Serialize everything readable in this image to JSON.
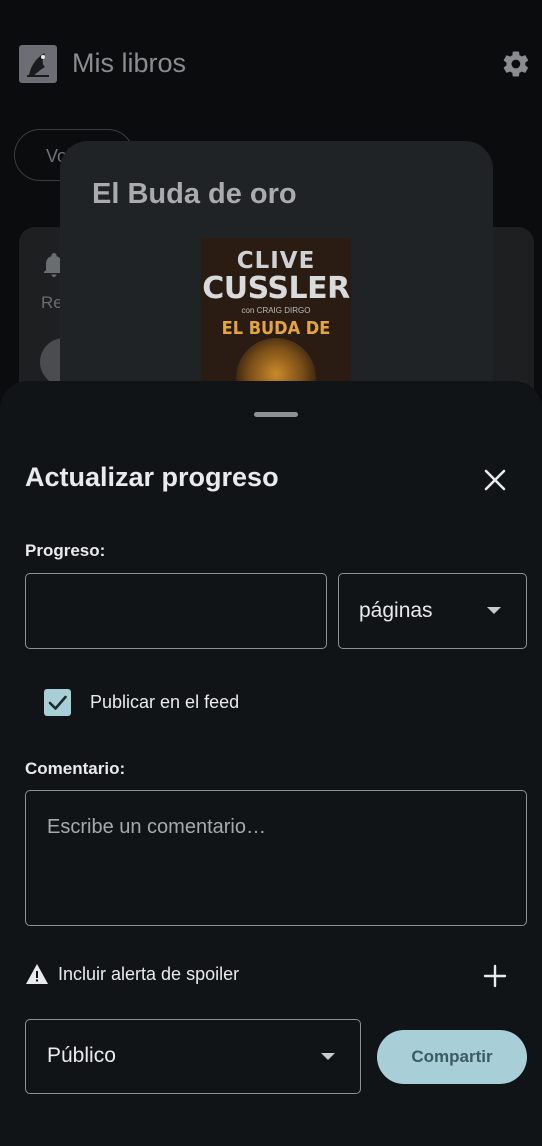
{
  "app": {
    "title": "Mis libros",
    "filter_chip": "Vol",
    "card_text_fragment": "Re"
  },
  "book": {
    "title": "El Buda de oro",
    "cover": {
      "author_first": "CLIVE",
      "author_last": "CUSSLER",
      "coauthor": "con CRAIG DIRGO",
      "title": "EL BUDA DE ORO"
    }
  },
  "sheet": {
    "title": "Actualizar progreso",
    "progress_label": "Progreso:",
    "progress_value": "",
    "unit_selected": "páginas",
    "post_to_feed_label": "Publicar en el feed",
    "post_to_feed_checked": true,
    "comment_label": "Comentario:",
    "comment_placeholder": "Escribe un comentario…",
    "spoiler_label": "Incluir alerta de spoiler",
    "visibility_selected": "Público",
    "share_label": "Compartir"
  },
  "colors": {
    "accent": "#a8cfd8",
    "sheet_bg": "#111416",
    "page_bg": "#0b0c0d"
  },
  "icons": [
    "gear-icon",
    "bell-icon",
    "close-icon",
    "chevron-down-icon",
    "checkmark-icon",
    "warning-icon",
    "plus-icon"
  ]
}
